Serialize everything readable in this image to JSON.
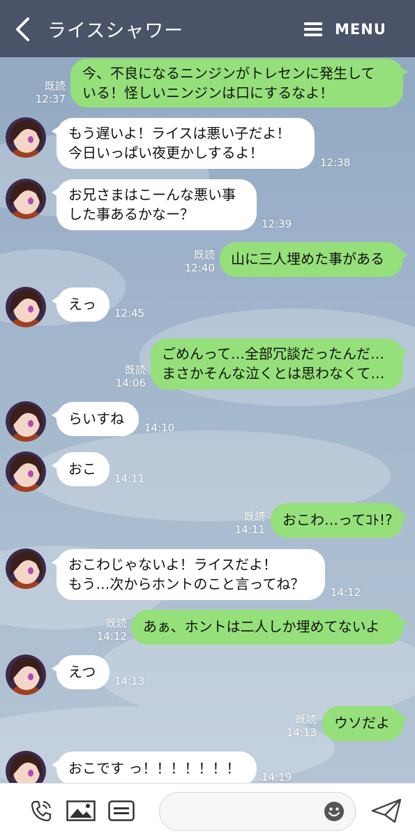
{
  "header": {
    "title": "ライスシャワー",
    "menu_label": "MENU"
  },
  "messages": [
    {
      "lines": [
        "今、不良になるニンジンがトレセンに発生して",
        "いる！怪しいニンジンは口にするなよ！"
      ],
      "read": "既読",
      "time": "12:37"
    },
    {
      "lines": [
        "もう遅いよ！ライスは悪い子だよ！",
        "今日いっぱい夜更かしするよ！"
      ],
      "time": "12:38"
    },
    {
      "lines": [
        "お兄さまはこーんな悪い事",
        "した事あるかなー？"
      ],
      "time": "12:39"
    },
    {
      "lines": [
        "山に三人埋めた事がある"
      ],
      "read": "既読",
      "time": "12:40"
    },
    {
      "lines": [
        "えっ"
      ],
      "time": "12:45"
    },
    {
      "lines": [
        "ごめんって…全部冗談だったんだ…",
        "まさかそんな泣くとは思わなくて…"
      ],
      "read": "既読",
      "time": "14:06"
    },
    {
      "lines": [
        "らいすね"
      ],
      "time": "14:10"
    },
    {
      "lines": [
        "おこ"
      ],
      "time": "14:11"
    },
    {
      "lines": [
        "おこわ…ってｺﾄ!?"
      ],
      "read": "既読",
      "time": "14:11"
    },
    {
      "lines": [
        "おこわじゃないよ！ライスだよ！",
        "もう…次からホントのこと言ってね？"
      ],
      "time": "14:12"
    },
    {
      "lines": [
        "あぁ、ホントは二人しか埋めてないよ"
      ],
      "read": "既読",
      "time": "14:12"
    },
    {
      "lines": [
        "えつ"
      ],
      "time": "14:13"
    },
    {
      "lines": [
        "ウソだよ"
      ],
      "read": "既読",
      "time": "14:13"
    },
    {
      "lines": [
        "おこです っ！！！！！！！"
      ],
      "time": "14:19"
    }
  ],
  "composer": {
    "placeholder": ""
  },
  "icons": [
    "back-chevron-icon",
    "menu-icon",
    "phone-icon",
    "image-icon",
    "keyboard-icon",
    "emoji-icon",
    "send-icon"
  ],
  "colors": {
    "header": "#4a5368",
    "outgoing_bubble": "#95e07a",
    "incoming_bubble": "#ffffff"
  }
}
